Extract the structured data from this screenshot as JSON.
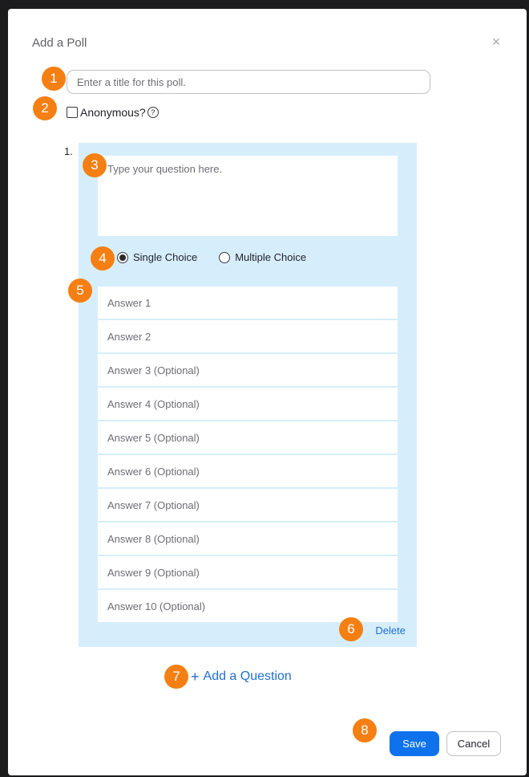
{
  "dialog": {
    "title": "Add a Poll",
    "close_icon": "close-icon",
    "close_symbol": "×"
  },
  "poll": {
    "title_placeholder": "Enter a title for this poll.",
    "title_value": "",
    "anonymous_label": "Anonymous?",
    "anonymous_checked": false,
    "help_symbol": "?"
  },
  "question": {
    "number": "1.",
    "placeholder": "Type your question here.",
    "value": "",
    "single_choice_label": "Single Choice",
    "multiple_choice_label": "Multiple Choice",
    "selected_type": "single",
    "answers": [
      "Answer 1",
      "Answer 2",
      "Answer 3 (Optional)",
      "Answer 4 (Optional)",
      "Answer 5 (Optional)",
      "Answer 6 (Optional)",
      "Answer 7 (Optional)",
      "Answer 8 (Optional)",
      "Answer 9 (Optional)",
      "Answer 10 (Optional)"
    ],
    "delete_label": "Delete"
  },
  "actions": {
    "add_question_label": "Add a Question",
    "plus_symbol": "+",
    "save_label": "Save",
    "cancel_label": "Cancel"
  },
  "badges": [
    "1",
    "2",
    "3",
    "4",
    "5",
    "6",
    "7",
    "8"
  ],
  "colors": {
    "badge": "#f57f12",
    "accent": "#0e72ed",
    "link": "#1e6fd0",
    "panel": "#d6eefc"
  }
}
